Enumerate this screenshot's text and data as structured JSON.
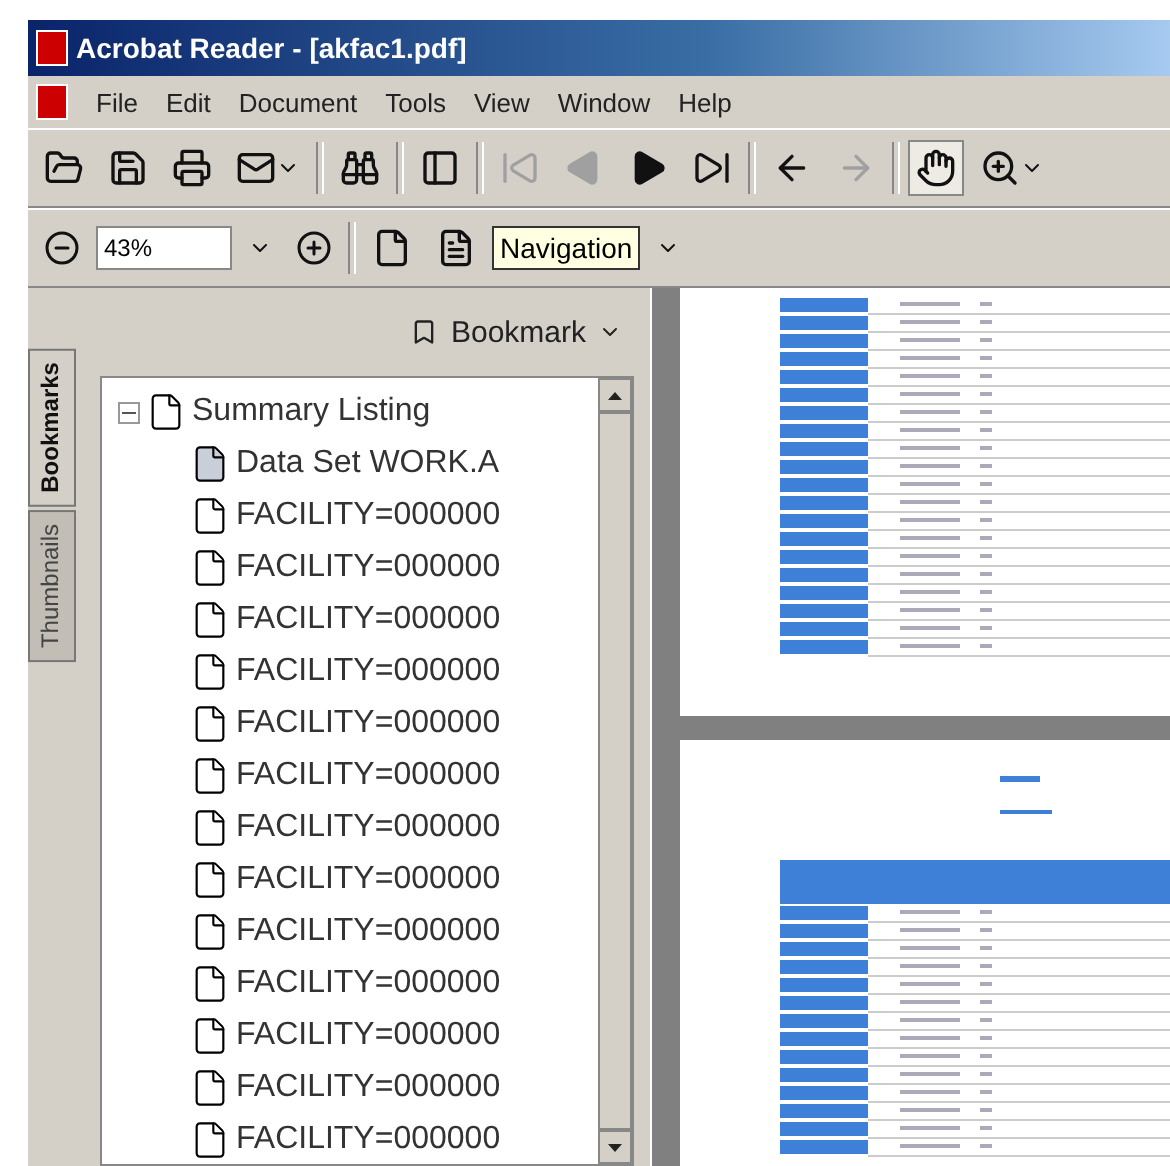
{
  "window": {
    "title": "Acrobat Reader - [akfac1.pdf]"
  },
  "menu": [
    "File",
    "Edit",
    "Document",
    "Tools",
    "View",
    "Window",
    "Help"
  ],
  "toolbar": [
    {
      "kind": "open",
      "disabled": false,
      "selected": false
    },
    {
      "kind": "save",
      "disabled": false,
      "selected": false
    },
    {
      "kind": "print",
      "disabled": false,
      "selected": false
    },
    {
      "kind": "email",
      "disabled": false,
      "selected": false,
      "dropdown": true
    },
    {
      "kind": "sep"
    },
    {
      "kind": "find",
      "disabled": false,
      "selected": false
    },
    {
      "kind": "sep"
    },
    {
      "kind": "panel",
      "disabled": false,
      "selected": false
    },
    {
      "kind": "sep"
    },
    {
      "kind": "first",
      "disabled": true,
      "selected": false
    },
    {
      "kind": "prev",
      "disabled": true,
      "selected": false
    },
    {
      "kind": "next",
      "disabled": false,
      "selected": false
    },
    {
      "kind": "last",
      "disabled": false,
      "selected": false
    },
    {
      "kind": "sep"
    },
    {
      "kind": "back",
      "disabled": false,
      "selected": false
    },
    {
      "kind": "forward",
      "disabled": true,
      "selected": false
    },
    {
      "kind": "sep"
    },
    {
      "kind": "hand",
      "disabled": false,
      "selected": true
    },
    {
      "kind": "zoom",
      "disabled": false,
      "selected": false,
      "dropdown": true
    }
  ],
  "zoom_bar": {
    "zoom_value": "43%",
    "tooltip": "Navigation"
  },
  "side_tabs": [
    {
      "label": "Bookmarks",
      "selected": true
    },
    {
      "label": "Thumbnails",
      "selected": false
    }
  ],
  "bookmark_menu": "Bookmark",
  "bookmarks": [
    {
      "label": "Summary Listing",
      "expanded": true,
      "children": [
        {
          "label": "Data Set WORK.A",
          "selected": true
        },
        {
          "label": "FACILITY=000000",
          "selected": false
        },
        {
          "label": "FACILITY=000000",
          "selected": false
        },
        {
          "label": "FACILITY=000000",
          "selected": false
        },
        {
          "label": "FACILITY=000000",
          "selected": false
        },
        {
          "label": "FACILITY=000000",
          "selected": false
        },
        {
          "label": "FACILITY=000000",
          "selected": false
        },
        {
          "label": "FACILITY=000000",
          "selected": false
        },
        {
          "label": "FACILITY=000000",
          "selected": false
        },
        {
          "label": "FACILITY=000000",
          "selected": false
        },
        {
          "label": "FACILITY=000000",
          "selected": false
        },
        {
          "label": "FACILITY=000000",
          "selected": false
        },
        {
          "label": "FACILITY=000000",
          "selected": false
        },
        {
          "label": "FACILITY=000000",
          "selected": false
        }
      ]
    }
  ]
}
